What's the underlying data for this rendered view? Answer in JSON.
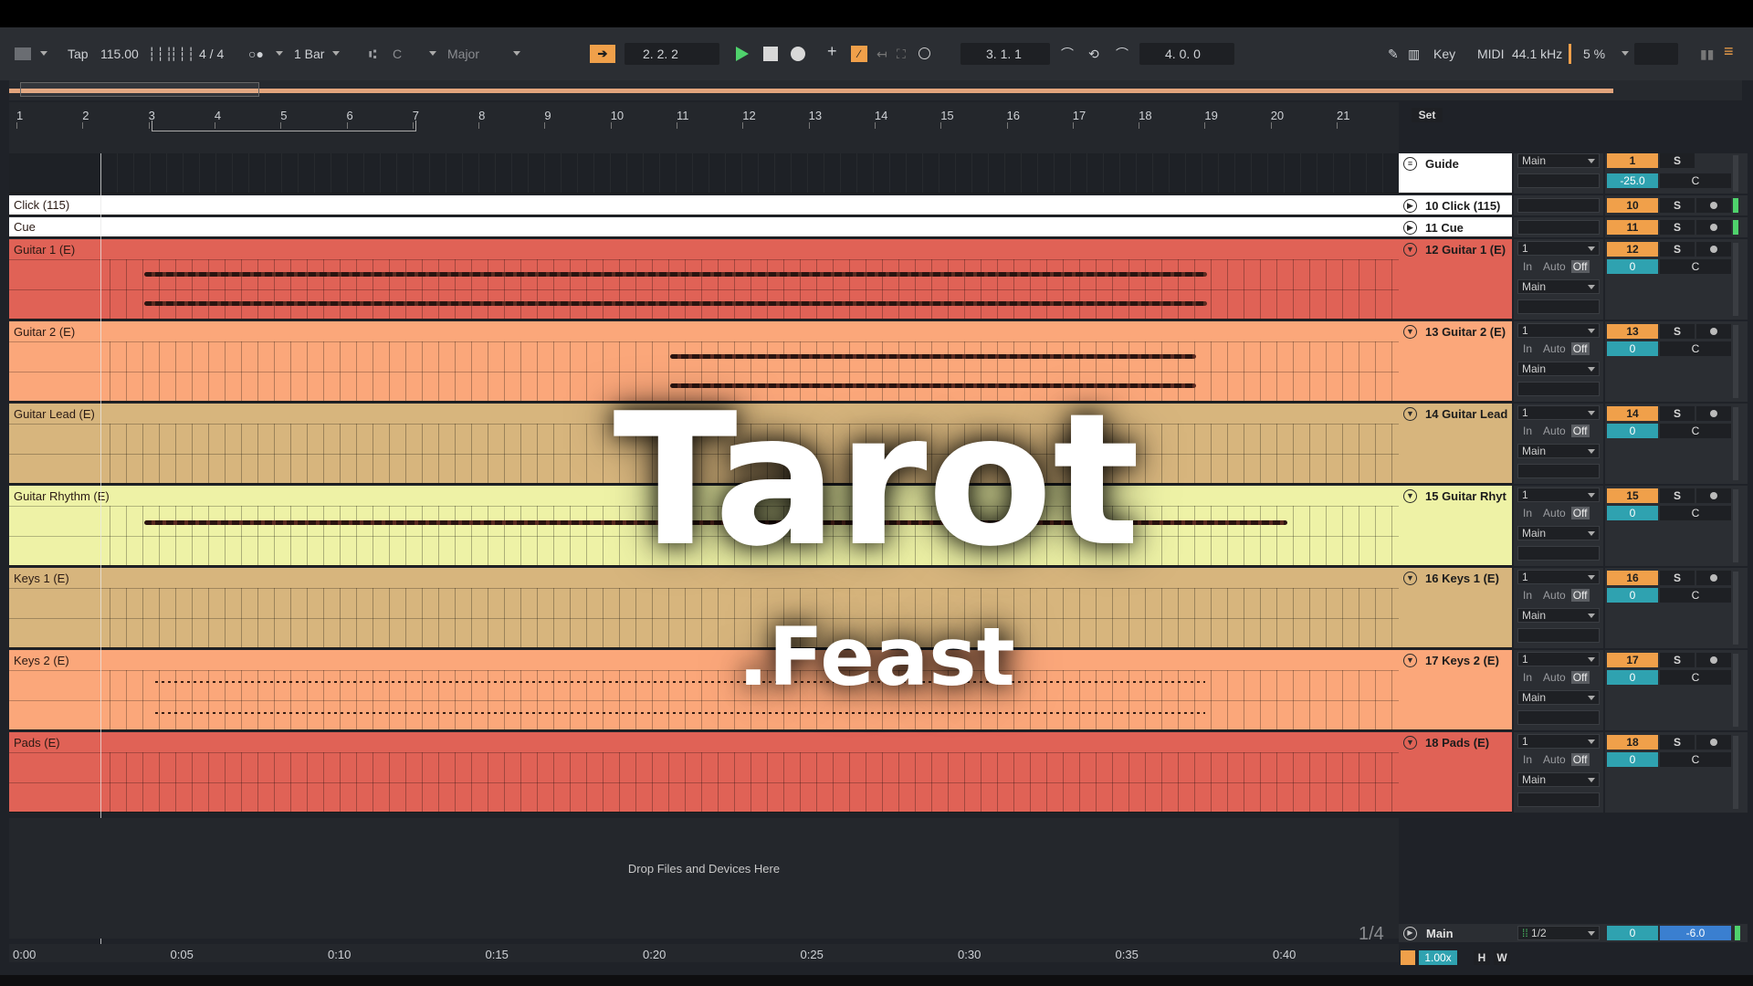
{
  "toolbar": {
    "tap": "Tap",
    "tempo": "115.00",
    "time_signature": "4 / 4",
    "quantize": "1 Bar",
    "key": "C",
    "scale": "Major",
    "arrangement_position": "2.  2.  2",
    "loop_start": "3.  1.  1",
    "loop_length": "4.  0.  0",
    "key_label": "Key",
    "midi_label": "MIDI",
    "sample_rate": "44.1 kHz",
    "cpu": "5 %"
  },
  "ruler": {
    "bars": [
      "1",
      "2",
      "3",
      "4",
      "5",
      "6",
      "7",
      "8",
      "9",
      "10",
      "11",
      "12",
      "13",
      "14",
      "15",
      "16",
      "17",
      "18",
      "19",
      "20",
      "21"
    ],
    "set_label": "Set"
  },
  "tracks": [
    {
      "name": "Click (115)",
      "header": "10 Click (115)",
      "num": "10",
      "color": "#ffffff"
    },
    {
      "name": "Cue",
      "header": "11 Cue",
      "num": "11",
      "color": "#ffffff"
    },
    {
      "name": "Guitar 1 (E)",
      "header": "12 Guitar 1 (E)",
      "num": "12",
      "color": "#e06256",
      "input": "1",
      "output": "Main",
      "vol": "0"
    },
    {
      "name": "Guitar 2 (E)",
      "header": "13 Guitar 2 (E)",
      "num": "13",
      "color": "#fba77a",
      "input": "1",
      "output": "Main",
      "vol": "0"
    },
    {
      "name": "Guitar Lead (E)",
      "header": "14 Guitar Lead",
      "num": "14",
      "color": "#d7b57d",
      "input": "1",
      "output": "Main",
      "vol": "0"
    },
    {
      "name": "Guitar Rhythm (E)",
      "header": "15 Guitar Rhyt",
      "num": "15",
      "color": "#eef2a6",
      "input": "1",
      "output": "Main",
      "vol": "0"
    },
    {
      "name": "Keys 1 (E)",
      "header": "16 Keys 1 (E)",
      "num": "16",
      "color": "#d7b57d",
      "input": "1",
      "output": "Main",
      "vol": "0"
    },
    {
      "name": "Keys 2 (E)",
      "header": "17 Keys 2 (E)",
      "num": "17",
      "color": "#fba77a",
      "input": "1",
      "output": "Main",
      "vol": "0"
    },
    {
      "name": "Pads (E)",
      "header": "18 Pads (E)",
      "num": "18",
      "color": "#e06256",
      "input": "1",
      "output": "Main",
      "vol": "0"
    }
  ],
  "guide": {
    "name": "Guide",
    "output": "Main",
    "num": "1",
    "vol": "-25.0"
  },
  "mixer_labels": {
    "s": "S",
    "c": "C",
    "in": "In",
    "auto": "Auto",
    "off": "Off"
  },
  "drop_text": "Drop Files and Devices Here",
  "main_track": {
    "name": "Main",
    "grid": "1/4",
    "routing": "1/2",
    "vol": "0",
    "pan": "-6.0"
  },
  "footer": {
    "zoom": "1.00x",
    "h": "H",
    "w": "W"
  },
  "time_labels": [
    "0:00",
    "0:05",
    "0:10",
    "0:15",
    "0:20",
    "0:25",
    "0:30",
    "0:35",
    "0:40"
  ],
  "overlay": {
    "title": "Tarot",
    "subtitle": ".Feast"
  }
}
